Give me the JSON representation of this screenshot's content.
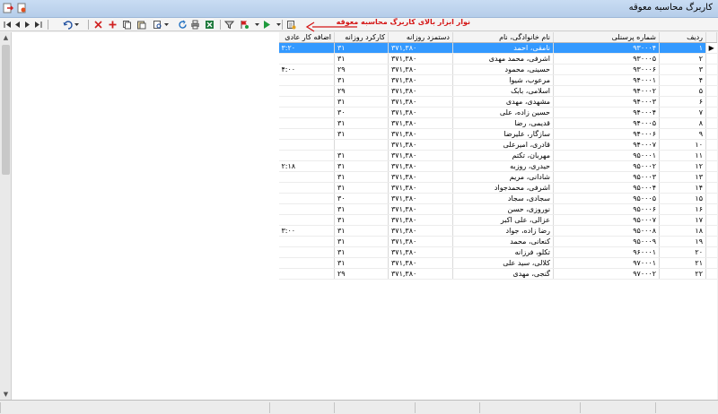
{
  "window": {
    "title": "کاربرگ محاسبه معوقه"
  },
  "toolbar": {
    "callout": "نوار ابزار بالای کاربرگ محاسبه معوقه",
    "icons": [
      "first-record-icon",
      "prev-record-icon",
      "next-record-icon",
      "last-record-icon",
      "undo-icon",
      "delete-icon",
      "add-icon",
      "copy-icon",
      "paste-icon",
      "print-preview-icon",
      "refresh-icon",
      "print-icon",
      "excel-icon",
      "filter-icon",
      "flag-icon",
      "run-icon",
      "report-icon"
    ]
  },
  "colors": {
    "selection": "#3399ff",
    "callout": "#d41616"
  },
  "grid": {
    "headers": [
      "ردیف",
      "شماره پرسنلی",
      "نام خانوادگی، نام",
      "دستمزد روزانه",
      "کارکرد روزانه",
      "اضافه کار عادی"
    ],
    "rows": [
      [
        "۱",
        "۹۳۰۰۰۴",
        "نامقی، احمد",
        "۳۷۱,۳۸۰",
        "۳۱",
        "۳:۲۰"
      ],
      [
        "۲",
        "۹۳۰۰۰۵",
        "اشرفی، محمد مهدی",
        "۳۷۱,۳۸۰",
        "۳۱",
        ""
      ],
      [
        "۳",
        "۹۳۰۰۰۶",
        "حسینی، محمود",
        "۳۷۱,۳۸۰",
        "۲۹",
        "۴:۰۰"
      ],
      [
        "۴",
        "۹۴۰۰۰۱",
        "مرعوب، شیوا",
        "۳۷۱,۳۸۰",
        "۳۱",
        ""
      ],
      [
        "۵",
        "۹۴۰۰۰۲",
        "اسلامی، بابک",
        "۳۷۱,۳۸۰",
        "۲۹",
        ""
      ],
      [
        "۶",
        "۹۴۰۰۰۳",
        "مشهدی، مهدی",
        "۳۷۱,۳۸۰",
        "۳۱",
        ""
      ],
      [
        "۷",
        "۹۴۰۰۰۴",
        "حسین زاده، علی",
        "۳۷۱,۳۸۰",
        "۳۰",
        ""
      ],
      [
        "۸",
        "۹۴۰۰۰۵",
        "قدیمی، رضا",
        "۳۷۱,۳۸۰",
        "۳۱",
        ""
      ],
      [
        "۹",
        "۹۴۰۰۰۶",
        "سازگار، علیرضا",
        "۳۷۱,۳۸۰",
        "۳۱",
        ""
      ],
      [
        "۱۰",
        "۹۴۰۰۰۷",
        "قادری، امیرعلی",
        "۳۷۱,۳۸۰",
        "",
        ""
      ],
      [
        "۱۱",
        "۹۵۰۰۰۱",
        "مهربان، تکتم",
        "۳۷۱,۳۸۰",
        "۳۱",
        ""
      ],
      [
        "۱۲",
        "۹۵۰۰۰۲",
        "حیدری، روزبه",
        "۳۷۱,۳۸۰",
        "۳۱",
        "۲:۱۸"
      ],
      [
        "۱۳",
        "۹۵۰۰۰۳",
        "شادانی، مریم",
        "۳۷۱,۳۸۰",
        "۳۱",
        ""
      ],
      [
        "۱۴",
        "۹۵۰۰۰۴",
        "اشرفی، محمدجواد",
        "۳۷۱,۳۸۰",
        "۳۱",
        ""
      ],
      [
        "۱۵",
        "۹۵۰۰۰۵",
        "سجادی، سجاد",
        "۳۷۱,۳۸۰",
        "۳۰",
        ""
      ],
      [
        "۱۶",
        "۹۵۰۰۰۶",
        "نوروزی، حسن",
        "۳۷۱,۳۸۰",
        "۳۱",
        ""
      ],
      [
        "۱۷",
        "۹۵۰۰۰۷",
        "عزالی، علی اکبر",
        "۳۷۱,۳۸۰",
        "۳۱",
        ""
      ],
      [
        "۱۸",
        "۹۵۰۰۰۸",
        "رضا زاده، جواد",
        "۳۷۱,۳۸۰",
        "۳۱",
        "۳:۰۰"
      ],
      [
        "۱۹",
        "۹۵۰۰۰۹",
        "کنعانی، محمد",
        "۳۷۱,۳۸۰",
        "۳۱",
        ""
      ],
      [
        "۲۰",
        "۹۶۰۰۰۱",
        "تکلو، فرزانه",
        "۳۷۱,۳۸۰",
        "۳۱",
        ""
      ],
      [
        "۲۱",
        "۹۷۰۰۰۱",
        "کلالی، سید علی",
        "۳۷۱,۳۸۰",
        "۳۱",
        ""
      ],
      [
        "۲۲",
        "۹۷۰۰۰۲",
        "گنجی، مهدی",
        "۳۷۱,۳۸۰",
        "۲۹",
        ""
      ]
    ]
  }
}
